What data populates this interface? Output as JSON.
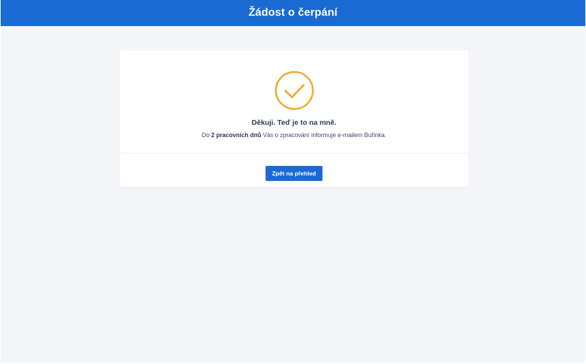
{
  "header": {
    "title": "Žádost o čerpání"
  },
  "confirmation": {
    "icon": "check-circle-icon",
    "icon_color": "#f0a92a",
    "headline": "Děkuji. Teď je to na mně.",
    "message_prefix": "Do ",
    "message_bold": "2 pracovních dnů",
    "message_suffix": " Vás o zpracování informuje e-mailem Buřinka."
  },
  "actions": {
    "back_label": "Zpět na přehled"
  },
  "colors": {
    "primary": "#1b6ad4",
    "background": "#f4f5f9",
    "card": "#ffffff",
    "accent": "#f0a92a"
  }
}
